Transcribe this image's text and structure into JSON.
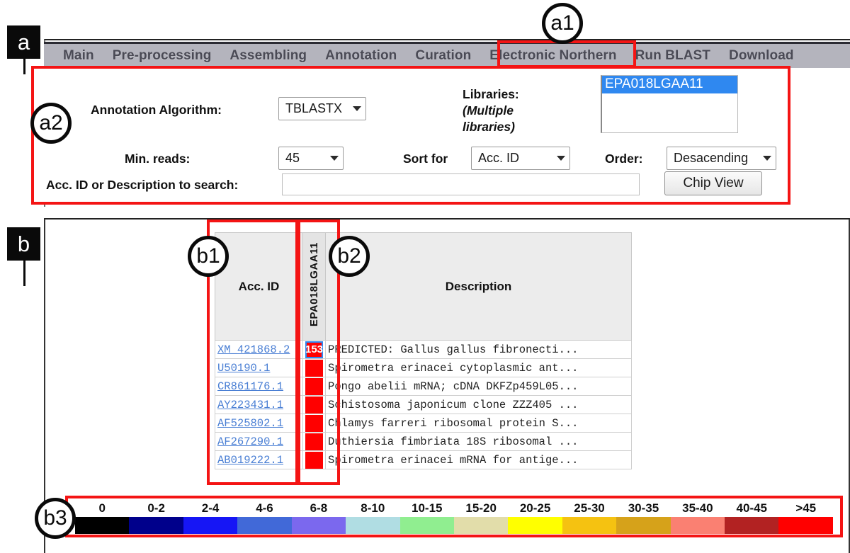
{
  "navbar": {
    "items": [
      {
        "label": "Main",
        "active": false
      },
      {
        "label": "Pre-processing",
        "active": false
      },
      {
        "label": "Assembling",
        "active": false
      },
      {
        "label": "Annotation",
        "active": false
      },
      {
        "label": "Curation",
        "active": false
      },
      {
        "label": "Electronic Northern",
        "active": true
      },
      {
        "label": "Run BLAST",
        "active": false
      },
      {
        "label": "Download",
        "active": false
      }
    ]
  },
  "form": {
    "annotation_algorithm_label": "Annotation Algorithm:",
    "annotation_algorithm_value": "TBLASTX",
    "libraries_label_line1": "Libraries:",
    "libraries_label_line2": "(Multiple",
    "libraries_label_line3": "libraries)",
    "libraries_selected_option": "EPA018LGAA11",
    "min_reads_label": "Min. reads:",
    "min_reads_value": "45",
    "sort_for_label": "Sort for",
    "sort_for_value": "Acc. ID",
    "order_label": "Order:",
    "order_value": "Desacending",
    "search_label": "Acc. ID or Description to search:",
    "search_value": "",
    "search_placeholder": "",
    "chip_view_label": "Chip View"
  },
  "table": {
    "headers": {
      "acc_id": "Acc. ID",
      "library": "EPA018LGAA11",
      "description": "Description"
    },
    "rows": [
      {
        "acc_id": "XM_421868.2",
        "count": "153",
        "selected": true,
        "color": "#ff0000",
        "description": "PREDICTED: Gallus gallus fibronecti..."
      },
      {
        "acc_id": "U50190.1",
        "count": "",
        "selected": false,
        "color": "#ff0000",
        "description": "Spirometra erinacei cytoplasmic ant..."
      },
      {
        "acc_id": "CR861176.1",
        "count": "",
        "selected": false,
        "color": "#ff0000",
        "description": "Pongo abelii mRNA; cDNA DKFZp459L05..."
      },
      {
        "acc_id": "AY223431.1",
        "count": "",
        "selected": false,
        "color": "#ff0000",
        "description": "Schistosoma japonicum clone ZZZ405 ..."
      },
      {
        "acc_id": "AF525802.1",
        "count": "",
        "selected": false,
        "color": "#ff0000",
        "description": "Chlamys farreri ribosomal protein S..."
      },
      {
        "acc_id": "AF267290.1",
        "count": "",
        "selected": false,
        "color": "#ff0000",
        "description": "Duthiersia fimbriata 18S ribosomal ..."
      },
      {
        "acc_id": "AB019222.1",
        "count": "",
        "selected": false,
        "color": "#ff0000",
        "description": "Spirometra erinacei mRNA for antige..."
      }
    ]
  },
  "legend": {
    "bins": [
      {
        "label": "0",
        "color": "#000000"
      },
      {
        "label": "0-2",
        "color": "#00008b"
      },
      {
        "label": "2-4",
        "color": "#1616f5"
      },
      {
        "label": "4-6",
        "color": "#4169d8"
      },
      {
        "label": "6-8",
        "color": "#7b68ee"
      },
      {
        "label": "8-10",
        "color": "#b0dde3"
      },
      {
        "label": "10-15",
        "color": "#90ee90"
      },
      {
        "label": "15-20",
        "color": "#e2ddaa"
      },
      {
        "label": "20-25",
        "color": "#ffff00"
      },
      {
        "label": "25-30",
        "color": "#f5c211"
      },
      {
        "label": "30-35",
        "color": "#d6a21a"
      },
      {
        "label": "35-40",
        "color": "#fa8072"
      },
      {
        "label": "40-45",
        "color": "#b22222"
      },
      {
        "label": ">45",
        "color": "#ff0000"
      }
    ]
  },
  "annotations": {
    "a": "a",
    "b": "b",
    "a1": "a1",
    "a2": "a2",
    "b1": "b1",
    "b2": "b2",
    "b3": "b3"
  },
  "colors": {
    "annotation_red": "#f41414",
    "nav_bg": "#b4b4bd",
    "selection_blue": "#2f88f0"
  }
}
